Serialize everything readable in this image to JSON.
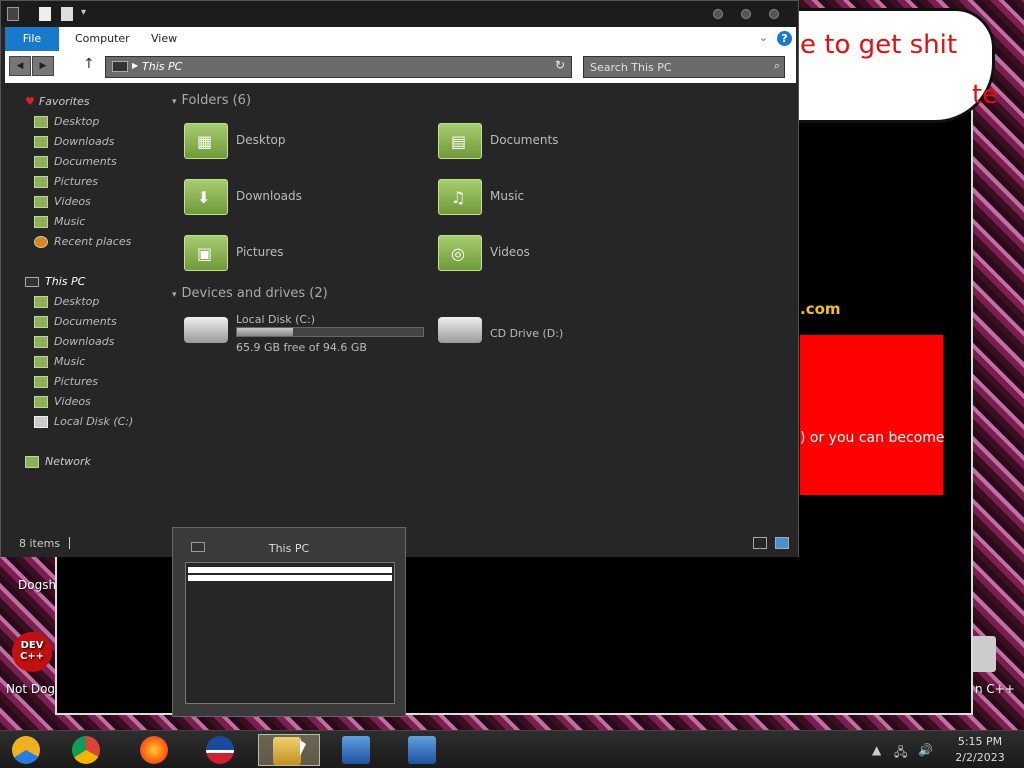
{
  "desktop": {
    "icons": [
      {
        "label": "Dogsh"
      },
      {
        "label": "Not Dog"
      },
      {
        "label": "DEV C++"
      },
      {
        "label": "n C++"
      }
    ]
  },
  "background_window": {
    "bubble_text": "e to get shit",
    "bubble_text2": "te",
    "domain_text": ".com",
    "red_text": ") or you can become"
  },
  "explorer": {
    "ribbon": {
      "file": "File",
      "computer": "Computer",
      "view": "View",
      "help": "?"
    },
    "address": "This PC",
    "search_placeholder": "Search This PC",
    "nav": {
      "favorites": "Favorites",
      "fav_items": [
        "Desktop",
        "Downloads",
        "Documents",
        "Pictures",
        "Videos",
        "Music",
        "Recent places"
      ],
      "this_pc": "This PC",
      "pc_items": [
        "Desktop",
        "Documents",
        "Downloads",
        "Music",
        "Pictures",
        "Videos",
        "Local Disk (C:)"
      ],
      "network": "Network"
    },
    "folders_header": "Folders (6)",
    "folders": [
      {
        "name": "Desktop",
        "icon": "desktop-folder-icon"
      },
      {
        "name": "Documents",
        "icon": "documents-folder-icon"
      },
      {
        "name": "Downloads",
        "icon": "downloads-folder-icon"
      },
      {
        "name": "Music",
        "icon": "music-folder-icon"
      },
      {
        "name": "Pictures",
        "icon": "pictures-folder-icon"
      },
      {
        "name": "Videos",
        "icon": "videos-folder-icon"
      }
    ],
    "devices_header": "Devices and drives (2)",
    "drives": [
      {
        "name": "Local Disk (C:)",
        "free": "65.9 GB free of 94.6 GB",
        "used_fraction": 0.3
      },
      {
        "name": "CD Drive (D:)"
      }
    ],
    "status": "8 items"
  },
  "thumbnail": {
    "title": "This PC"
  },
  "taskbar": {
    "apps": [
      "chrome-canary",
      "chrome",
      "firefox",
      "obama",
      "file-explorer",
      "installer-1",
      "installer-2"
    ],
    "time": "5:15 PM",
    "date": "2/2/2023"
  },
  "colors": {
    "accent": "#1979ca",
    "folder_green": "#8fb05a",
    "red": "#ff0000"
  }
}
